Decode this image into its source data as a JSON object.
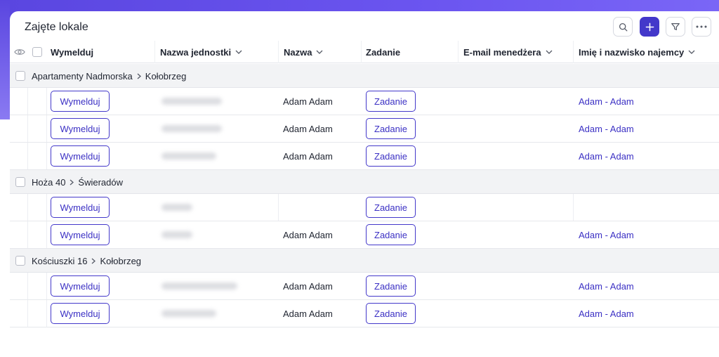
{
  "header": {
    "title": "Zajęte lokale"
  },
  "toolbar": {
    "search_icon": "search-icon",
    "add_icon": "plus-icon",
    "filter_icon": "filter-icon",
    "more_icon": "more-icon",
    "accent": "#4338ca"
  },
  "columns": {
    "checkout": "Wymelduj",
    "unit_name": "Nazwa jednostki",
    "name": "Nazwa",
    "task": "Zadanie",
    "manager_email": "E-mail menedżera",
    "tenant": "Imię i nazwisko najemcy"
  },
  "groups": [
    {
      "address": "Apartamenty Nadmorska",
      "city": "Kołobrzeg",
      "rows": [
        {
          "checkout": "Wymelduj",
          "name": "Adam Adam",
          "task": "Zadanie",
          "tenant": "Adam - Adam"
        },
        {
          "checkout": "Wymelduj",
          "name": "Adam Adam",
          "task": "Zadanie",
          "tenant": "Adam - Adam"
        },
        {
          "checkout": "Wymelduj",
          "name": "Adam Adam",
          "task": "Zadanie",
          "tenant": "Adam - Adam"
        }
      ]
    },
    {
      "address": "Hoża 40",
      "city": "Świeradów",
      "rows": [
        {
          "checkout": "Wymelduj",
          "name": "",
          "task": "Zadanie",
          "tenant": ""
        },
        {
          "checkout": "Wymelduj",
          "name": "Adam Adam",
          "task": "Zadanie",
          "tenant": "Adam - Adam"
        }
      ]
    },
    {
      "address": "Kościuszki 16",
      "city": "Kołobrzeg",
      "rows": [
        {
          "checkout": "Wymelduj",
          "name": "Adam Adam",
          "task": "Zadanie",
          "tenant": "Adam - Adam"
        },
        {
          "checkout": "Wymelduj",
          "name": "Adam Adam",
          "task": "Zadanie",
          "tenant": "Adam - Adam"
        }
      ]
    }
  ]
}
